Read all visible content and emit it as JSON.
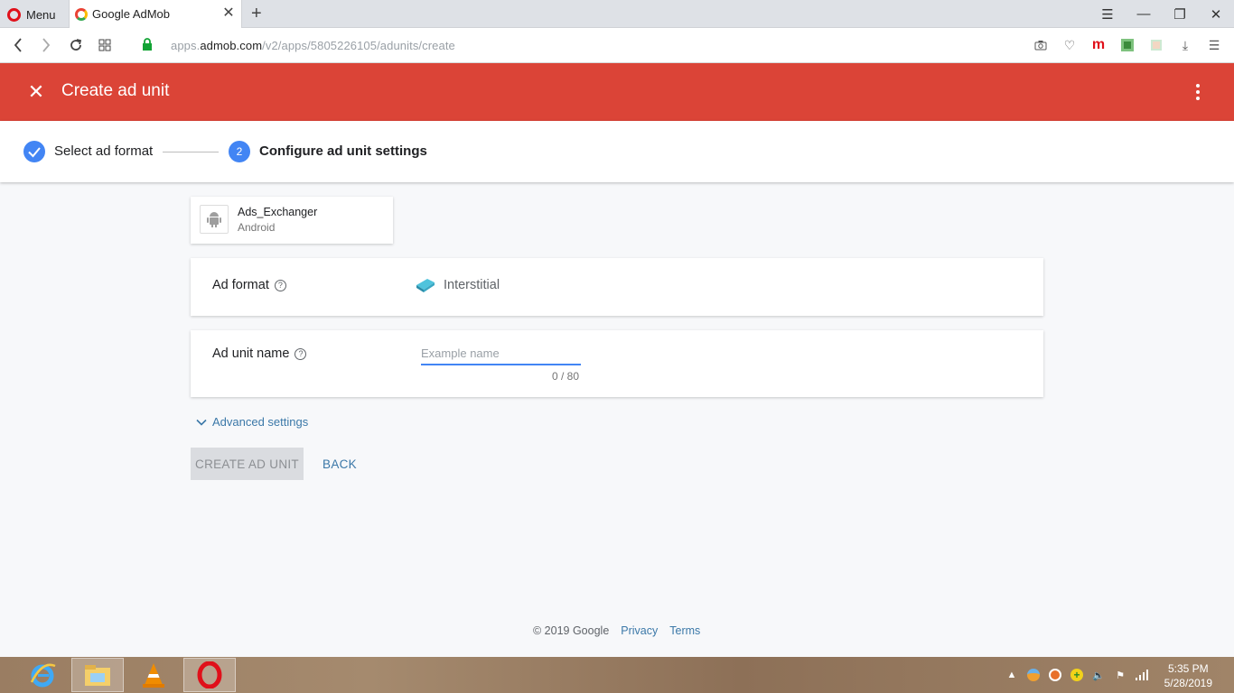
{
  "browser": {
    "menu_label": "Menu",
    "tab_title": "Google AdMob",
    "url_prefix": "apps.",
    "url_domain": "admob.com",
    "url_path": "/v2/apps/5805226105/adunits/create"
  },
  "header": {
    "title": "Create ad unit"
  },
  "stepper": {
    "step1_label": "Select ad format",
    "step2_number": "2",
    "step2_label": "Configure ad unit settings"
  },
  "app": {
    "name": "Ads_Exchanger",
    "platform": "Android"
  },
  "ad_format": {
    "label": "Ad format",
    "value": "Interstitial"
  },
  "ad_unit_name": {
    "label": "Ad unit name",
    "placeholder": "Example name",
    "value": "",
    "count": "0 / 80"
  },
  "advanced_label": "Advanced settings",
  "actions": {
    "create_label": "CREATE AD UNIT",
    "back_label": "BACK"
  },
  "footer": {
    "copyright": "© 2019 Google",
    "privacy": "Privacy",
    "terms": "Terms"
  },
  "taskbar": {
    "time": "5:35 PM",
    "date": "5/28/2019"
  },
  "colors": {
    "header_red": "#db4437",
    "accent_blue": "#4285f4",
    "link_blue": "#3b78a8"
  }
}
